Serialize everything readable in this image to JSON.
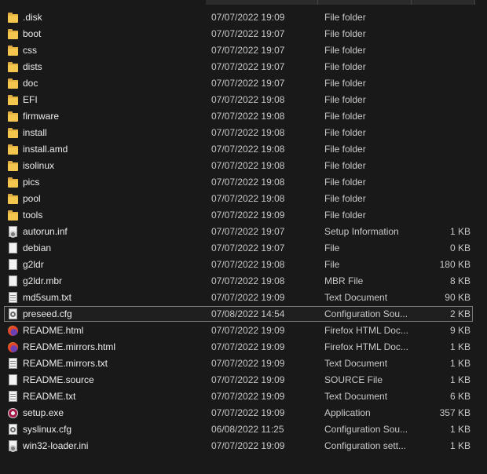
{
  "files": [
    {
      "name": ".disk",
      "date": "07/07/2022 19:09",
      "type": "File folder",
      "size": "",
      "icon": "folder-icon"
    },
    {
      "name": "boot",
      "date": "07/07/2022 19:07",
      "type": "File folder",
      "size": "",
      "icon": "folder-icon"
    },
    {
      "name": "css",
      "date": "07/07/2022 19:07",
      "type": "File folder",
      "size": "",
      "icon": "folder-icon"
    },
    {
      "name": "dists",
      "date": "07/07/2022 19:07",
      "type": "File folder",
      "size": "",
      "icon": "folder-icon"
    },
    {
      "name": "doc",
      "date": "07/07/2022 19:07",
      "type": "File folder",
      "size": "",
      "icon": "folder-icon"
    },
    {
      "name": "EFI",
      "date": "07/07/2022 19:08",
      "type": "File folder",
      "size": "",
      "icon": "folder-icon"
    },
    {
      "name": "firmware",
      "date": "07/07/2022 19:08",
      "type": "File folder",
      "size": "",
      "icon": "folder-icon"
    },
    {
      "name": "install",
      "date": "07/07/2022 19:08",
      "type": "File folder",
      "size": "",
      "icon": "folder-icon"
    },
    {
      "name": "install.amd",
      "date": "07/07/2022 19:08",
      "type": "File folder",
      "size": "",
      "icon": "folder-icon"
    },
    {
      "name": "isolinux",
      "date": "07/07/2022 19:08",
      "type": "File folder",
      "size": "",
      "icon": "folder-icon"
    },
    {
      "name": "pics",
      "date": "07/07/2022 19:08",
      "type": "File folder",
      "size": "",
      "icon": "folder-icon"
    },
    {
      "name": "pool",
      "date": "07/07/2022 19:08",
      "type": "File folder",
      "size": "",
      "icon": "folder-icon"
    },
    {
      "name": "tools",
      "date": "07/07/2022 19:09",
      "type": "File folder",
      "size": "",
      "icon": "folder-icon"
    },
    {
      "name": "autorun.inf",
      "date": "07/07/2022 19:07",
      "type": "Setup Information",
      "size": "1 KB",
      "icon": "settings-file-icon"
    },
    {
      "name": "debian",
      "date": "07/07/2022 19:07",
      "type": "File",
      "size": "0 KB",
      "icon": "blank-file-icon"
    },
    {
      "name": "g2ldr",
      "date": "07/07/2022 19:08",
      "type": "File",
      "size": "180 KB",
      "icon": "blank-file-icon"
    },
    {
      "name": "g2ldr.mbr",
      "date": "07/07/2022 19:08",
      "type": "MBR File",
      "size": "8 KB",
      "icon": "blank-file-icon"
    },
    {
      "name": "md5sum.txt",
      "date": "07/07/2022 19:09",
      "type": "Text Document",
      "size": "90 KB",
      "icon": "text-file-icon"
    },
    {
      "name": "preseed.cfg",
      "date": "07/08/2022 14:54",
      "type": "Configuration Sou...",
      "size": "2 KB",
      "icon": "config-file-icon",
      "selected": true
    },
    {
      "name": "README.html",
      "date": "07/07/2022 19:09",
      "type": "Firefox HTML Doc...",
      "size": "9 KB",
      "icon": "firefox-icon"
    },
    {
      "name": "README.mirrors.html",
      "date": "07/07/2022 19:09",
      "type": "Firefox HTML Doc...",
      "size": "1 KB",
      "icon": "firefox-icon"
    },
    {
      "name": "README.mirrors.txt",
      "date": "07/07/2022 19:09",
      "type": "Text Document",
      "size": "1 KB",
      "icon": "text-file-icon"
    },
    {
      "name": "README.source",
      "date": "07/07/2022 19:09",
      "type": "SOURCE File",
      "size": "1 KB",
      "icon": "blank-file-icon"
    },
    {
      "name": "README.txt",
      "date": "07/07/2022 19:09",
      "type": "Text Document",
      "size": "6 KB",
      "icon": "text-file-icon"
    },
    {
      "name": "setup.exe",
      "date": "07/07/2022 19:09",
      "type": "Application",
      "size": "357 KB",
      "icon": "application-icon"
    },
    {
      "name": "syslinux.cfg",
      "date": "06/08/2022 11:25",
      "type": "Configuration Sou...",
      "size": "1 KB",
      "icon": "config-file-icon"
    },
    {
      "name": "win32-loader.ini",
      "date": "07/07/2022 19:09",
      "type": "Configuration sett...",
      "size": "1 KB",
      "icon": "settings-file-icon"
    }
  ]
}
